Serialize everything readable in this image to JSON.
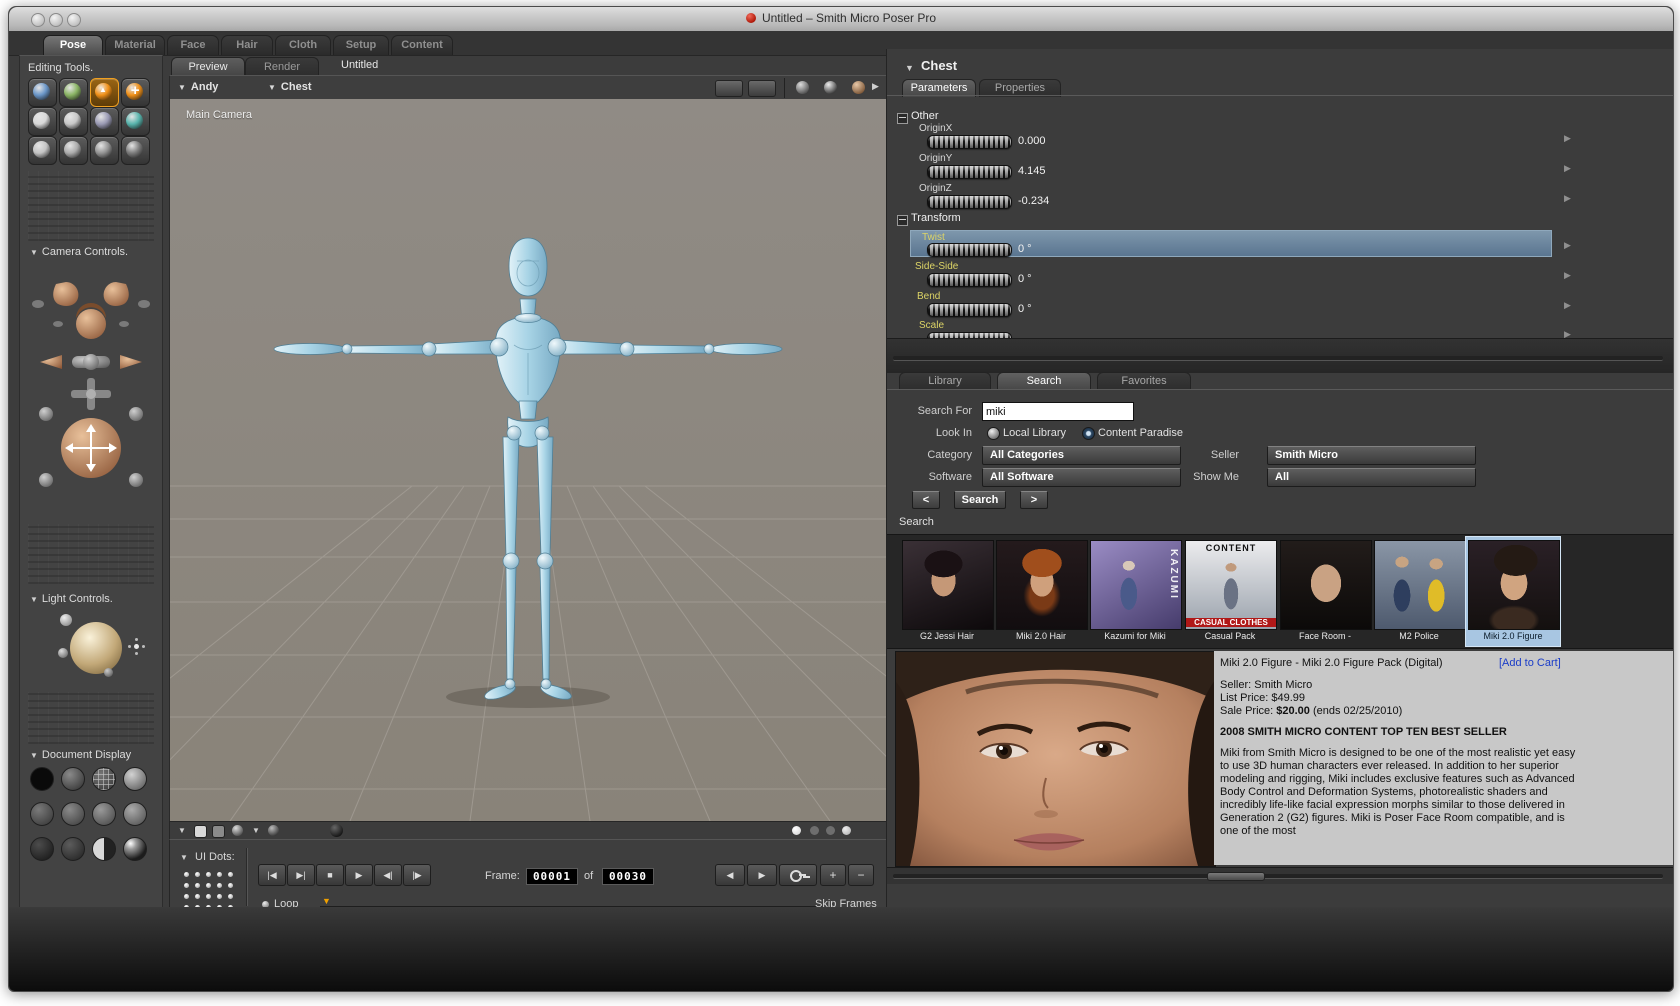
{
  "window": {
    "title": "Untitled – Smith Micro Poser Pro"
  },
  "room_tabs": {
    "items": [
      {
        "label": "Pose"
      },
      {
        "label": "Material"
      },
      {
        "label": "Face"
      },
      {
        "label": "Hair"
      },
      {
        "label": "Cloth"
      },
      {
        "label": "Setup"
      },
      {
        "label": "Content"
      }
    ]
  },
  "sidebar": {
    "editing_tools_title": "Editing Tools.",
    "camera_controls_title": "Camera Controls.",
    "light_controls_title": "Light Controls.",
    "document_display_title": "Document Display"
  },
  "viewport": {
    "tab_preview": "Preview",
    "tab_render": "Render",
    "doc_title": "Untitled",
    "figure_menu": "Andy",
    "actor_menu": "Chest",
    "camera_label": "Main Camera"
  },
  "timeline": {
    "ui_dots_label": "UI Dots:",
    "frame_label": "Frame:",
    "frame_current": "00001",
    "of_label": "of",
    "frame_total": "00030",
    "loop_label": "Loop",
    "skip_frames_label": "Skip Frames"
  },
  "parameters": {
    "title": "Chest",
    "tab_parameters": "Parameters",
    "tab_properties": "Properties",
    "group_other": "Other",
    "group_transform": "Transform",
    "params": {
      "originx": {
        "label": "OriginX",
        "value": "0.000"
      },
      "originy": {
        "label": "OriginY",
        "value": "4.145"
      },
      "originz": {
        "label": "OriginZ",
        "value": "-0.234"
      },
      "twist": {
        "label": "Twist",
        "value": "0 °"
      },
      "sideside": {
        "label": "Side-Side",
        "value": "0 °"
      },
      "bend": {
        "label": "Bend",
        "value": "0 °"
      },
      "scale": {
        "label": "Scale"
      }
    }
  },
  "library": {
    "tab_library": "Library",
    "tab_search": "Search",
    "tab_favorites": "Favorites",
    "search_for_label": "Search For",
    "search_value": "miki",
    "look_in_label": "Look In",
    "radio_local_label": "Local Library",
    "radio_paradise_label": "Content Paradise",
    "category_label": "Category",
    "category_value": "All Categories",
    "seller_label": "Seller",
    "seller_value": "Smith Micro",
    "software_label": "Software",
    "software_value": "All Software",
    "show_me_label": "Show Me",
    "show_me_value": "All",
    "prev_label": "<",
    "search_button_label": "Search",
    "next_label": ">",
    "results_section_label": "Search"
  },
  "results": {
    "items": [
      {
        "label": "G2 Jessi Hair"
      },
      {
        "label": "Miki 2.0 Hair"
      },
      {
        "label": "Kazumi for Miki",
        "overlay": "KAZUMI"
      },
      {
        "label": "Casual Pack",
        "overlay_top": "CONTENT",
        "overlay_bottom": "CASUAL CLOTHES"
      },
      {
        "label": "Face Room -"
      },
      {
        "label": "M2 Police"
      },
      {
        "label": "Miki 2.0 Figure"
      }
    ]
  },
  "detail": {
    "title": "Miki 2.0 Figure - Miki 2.0 Figure Pack (Digital)",
    "add_to_cart": "[Add to Cart]",
    "seller": "Seller: Smith Micro",
    "list_price": "List Price: $49.99",
    "sale_price_label": "Sale Price: ",
    "sale_price_value": "$20.00",
    "sale_price_suffix": " (ends 02/25/2010)",
    "banner": "2008 SMITH MICRO CONTENT TOP TEN BEST SELLER",
    "description": "Miki from Smith Micro is designed to be one of the most realistic yet easy to use 3D human characters ever released. In addition to her superior modeling and rigging, Miki includes exclusive features such as Advanced Body Control and Deformation Systems, photorealistic shaders and incredibly life-like facial expression morphs similar to those delivered in Generation 2 (G2) figures. Miki is Poser Face Room compatible, and is one of the most"
  },
  "colors": {
    "accent_orange": "#f09018",
    "highlight_row": "#6e8ba3",
    "param_label_yellow": "#ddd466",
    "link_blue": "#1a3cc8",
    "selected_thumb": "#a8c6e2"
  }
}
